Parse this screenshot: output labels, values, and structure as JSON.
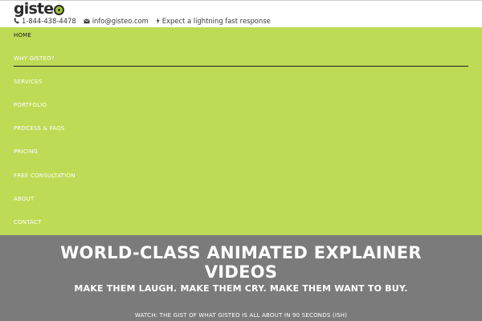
{
  "brand": {
    "logo_text": "giste",
    "logo_letter": "o",
    "accent": "#bddb55"
  },
  "topbar": {
    "phone": "1-844-438-4478",
    "email": "info@gisteo.com",
    "tagline": "Expect a lightning fast response",
    "icons": [
      "phone-icon",
      "envelope-icon",
      "lightning-icon"
    ]
  },
  "nav": {
    "items": [
      {
        "label": "HOME",
        "active": true
      },
      {
        "label": "WHY GISTEO?"
      },
      {
        "label": "SERVICES"
      },
      {
        "label": "PORTFOLIO"
      },
      {
        "label": "PROCESS & FAQS"
      },
      {
        "label": "PRICING"
      },
      {
        "label": "FREE CONSULTATION"
      },
      {
        "label": "ABOUT"
      },
      {
        "label": "CONTACT"
      }
    ]
  },
  "hero": {
    "title": "WORLD-CLASS ANIMATED EXPLAINER VIDEOS",
    "subtitle": "MAKE THEM LAUGH. MAKE THEM CRY. MAKE THEM WANT TO BUY.",
    "watch_link": "WATCH: THE GIST OF WHAT GISTEO IS ALL ABOUT IN 90 SECONDS (ISH)",
    "background": "#7b7b7b"
  }
}
